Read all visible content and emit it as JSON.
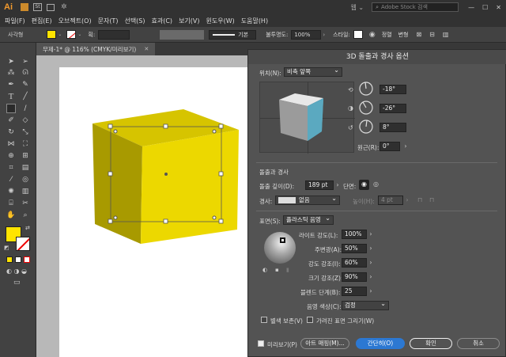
{
  "app": {
    "logo": "Ai",
    "search_placeholder": "Adobe Stock 검색"
  },
  "menu": [
    "파일(F)",
    "편집(E)",
    "오브젝트(O)",
    "문자(T)",
    "선택(S)",
    "효과(C)",
    "보기(V)",
    "윈도우(W)",
    "도움말(H)"
  ],
  "control": {
    "object_type": "사각형",
    "stroke_label": "획:",
    "stroke_style": "기본",
    "opacity_label": "불투명도:",
    "opacity": "100%",
    "style_label": "스타일:",
    "align_label": "정렬",
    "transform_label": "변형"
  },
  "tab": {
    "title": "무제-1* @ 116% (CMYK/미리보기)"
  },
  "colors": {
    "fill": "#ffe400",
    "cube_front": "#ecd800",
    "cube_top": "#d6c400",
    "cube_side": "#a89a00",
    "accent": "#2c78d2",
    "dialog_bg": "#535353"
  },
  "dialog": {
    "title": "3D 돌출과 경사 옵션",
    "position_label": "위치(N):",
    "position_value": "비축 앞쪽",
    "rot_x": "-18°",
    "rot_y": "-26°",
    "rot_z": "8°",
    "perspective_label": "원근(R):",
    "perspective": "0°",
    "section_extrude": "돌출과 경사",
    "depth_label": "돌출 깊이(D):",
    "depth": "189 pt",
    "cap_label": "단면:",
    "bevel_label": "경사:",
    "bevel": "없음",
    "height_label": "높이(H):",
    "height": "4 pt",
    "surface_label": "표면(S):",
    "surface": "플라스틱 음영",
    "light_intensity_label": "라이트 강도(L):",
    "light_intensity": "100%",
    "ambient_label": "주변광(A):",
    "ambient": "50%",
    "highlight_intensity_label": "강도 강조(I):",
    "highlight_intensity": "60%",
    "highlight_size_label": "크기 강조(Z):",
    "highlight_size": "90%",
    "blend_steps_label": "블렌드 단계(B):",
    "blend_steps": "25",
    "shade_color_label": "음영 색상(C):",
    "shade_color": "검정",
    "preserve_spot": "별색 보존(V)",
    "draw_hidden": "가려진 표면 그리기(W)",
    "preview": "미리보기(P)",
    "map_art": "아트 매핑(M)...",
    "fewer_options": "간단히(O)",
    "ok": "확인",
    "cancel": "취소"
  }
}
